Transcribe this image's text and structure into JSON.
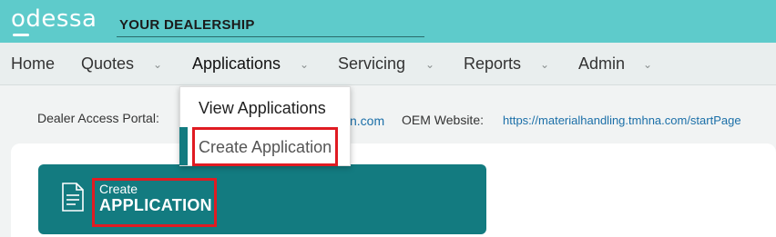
{
  "app": {
    "logo": "odessa",
    "dealership": "YOUR DEALERSHIP"
  },
  "nav": {
    "home": "Home",
    "quotes": "Quotes",
    "applications": "Applications",
    "servicing": "Servicing",
    "reports": "Reports",
    "admin": "Admin",
    "chevron": "⌄"
  },
  "dropdown": {
    "view": "View Applications",
    "create": "Create Application"
  },
  "links": {
    "portal_label": "Dealer Access Portal:",
    "portal_tail": "n.com",
    "oem_label": "OEM Website:",
    "oem_url": "https://materialhandling.tmhna.com/startPage"
  },
  "tile": {
    "small": "Create",
    "big": "APPLICATION",
    "icon": "document-icon"
  },
  "colors": {
    "header": "#5ecbcb",
    "accent": "#137b80",
    "highlight": "#e01b22"
  }
}
